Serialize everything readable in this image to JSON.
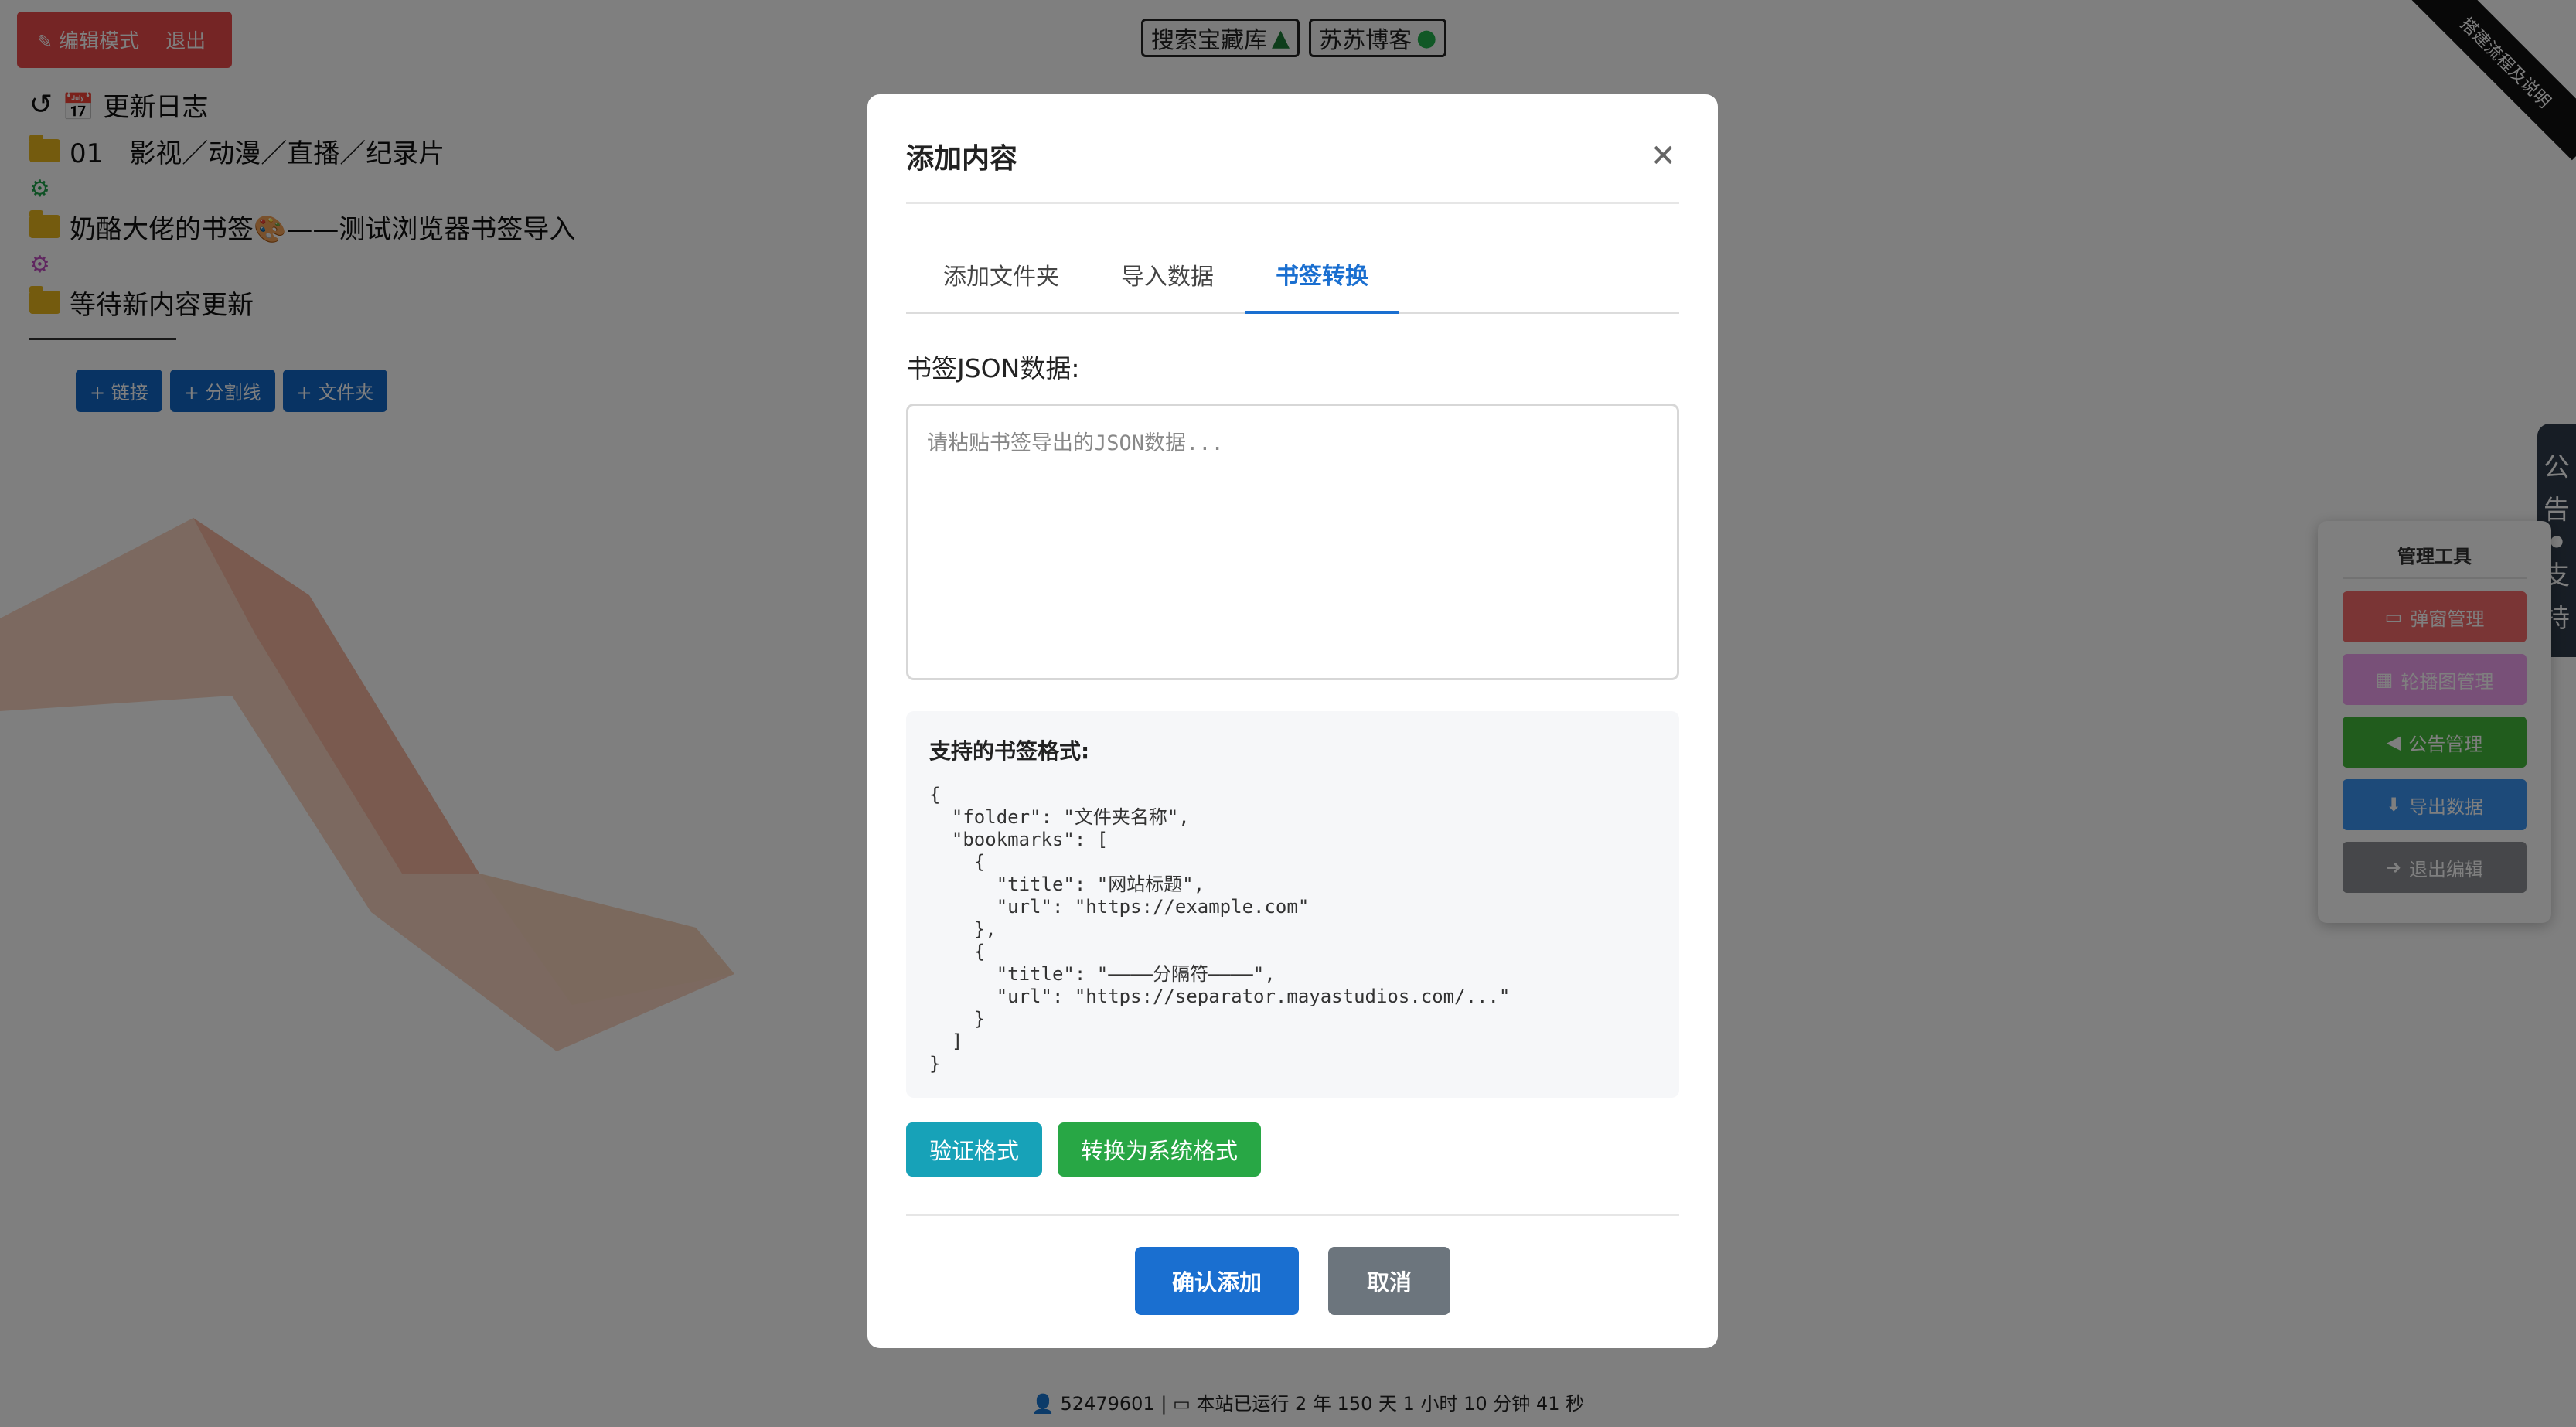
{
  "top_bar": {
    "edit_mode": "编辑模式",
    "logout": "退出",
    "links": [
      {
        "label": "搜索宝藏库",
        "icon": "tree-icon"
      },
      {
        "label": "苏苏博客",
        "icon": "wechat-icon"
      }
    ],
    "ribbon": "搭建流程及说明"
  },
  "sidebar": {
    "items": [
      {
        "label": "📅 更新日志"
      },
      {
        "label": "01　影视／动漫／直播／纪录片"
      },
      {
        "label": "奶酪大佬的书签🎨——测试浏览器书签导入"
      },
      {
        "label": "等待新内容更新"
      }
    ],
    "buttons": [
      "+ 链接",
      "+ 分割线",
      "+ 文件夹"
    ]
  },
  "footer_stat": {
    "visits": "52479601",
    "uptime": "本站已运行 2 年 150 天 1 小时 10 分钟 41 秒"
  },
  "notice_tab": [
    "公",
    "告",
    "●",
    "支",
    "持"
  ],
  "admin": {
    "title": "管理工具",
    "buttons": [
      {
        "label": "弹窗管理",
        "icon": "window-icon",
        "color": "#f46a6a"
      },
      {
        "label": "轮播图管理",
        "icon": "film-icon",
        "color": "#f0a0f0"
      },
      {
        "label": "公告管理",
        "icon": "megaphone-icon",
        "color": "#42b83a"
      },
      {
        "label": "导出数据",
        "icon": "download-icon",
        "color": "#3a95f2"
      },
      {
        "label": "退出编辑",
        "icon": "exit-icon",
        "color": "#8c8f94"
      }
    ]
  },
  "modal": {
    "title": "添加内容",
    "tabs": [
      "添加文件夹",
      "导入数据",
      "书签转换"
    ],
    "active_tab": "书签转换",
    "field_label": "书签JSON数据:",
    "placeholder": "请粘贴书签导出的JSON数据...",
    "format_title": "支持的书签格式:",
    "format_code": "{\n  \"folder\": \"文件夹名称\",\n  \"bookmarks\": [\n    {\n      \"title\": \"网站标题\",\n      \"url\": \"https://example.com\"\n    },\n    {\n      \"title\": \"————分隔符————\",\n      \"url\": \"https://separator.mayastudios.com/...\"\n    }\n  ]\n}",
    "validate_label": "验证格式",
    "convert_label": "转换为系统格式",
    "confirm_label": "确认添加",
    "cancel_label": "取消"
  }
}
